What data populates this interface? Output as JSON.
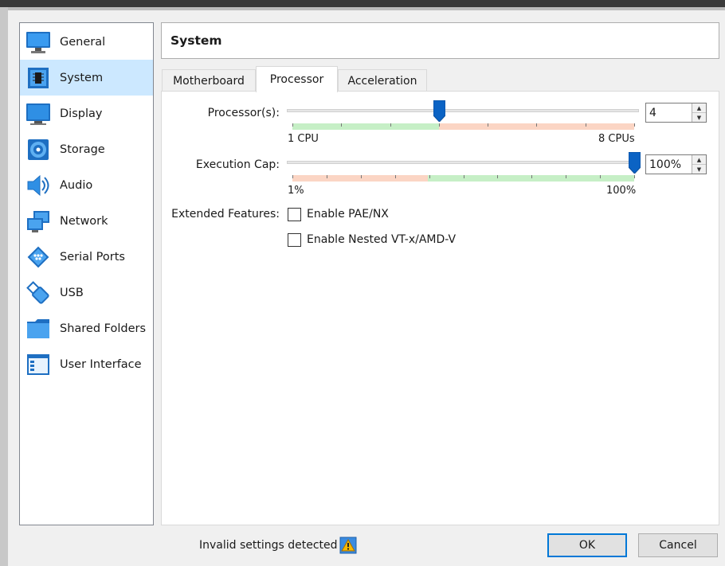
{
  "sidebar": {
    "items": [
      {
        "label": "General",
        "icon": "monitor-icon"
      },
      {
        "label": "System",
        "icon": "chip-icon",
        "selected": true
      },
      {
        "label": "Display",
        "icon": "display-icon"
      },
      {
        "label": "Storage",
        "icon": "disk-icon"
      },
      {
        "label": "Audio",
        "icon": "speaker-icon"
      },
      {
        "label": "Network",
        "icon": "network-icon"
      },
      {
        "label": "Serial Ports",
        "icon": "serial-port-icon"
      },
      {
        "label": "USB",
        "icon": "usb-icon"
      },
      {
        "label": "Shared Folders",
        "icon": "folder-icon"
      },
      {
        "label": "User Interface",
        "icon": "window-icon"
      }
    ]
  },
  "header": {
    "title": "System"
  },
  "tabs": [
    {
      "label": "Motherboard"
    },
    {
      "label": "Processor",
      "active": true
    },
    {
      "label": "Acceleration"
    }
  ],
  "processor": {
    "processors_label": "Processor(s):",
    "processors_value": "4",
    "processors_min_label": "1 CPU",
    "processors_max_label": "8 CPUs",
    "processors_fraction": 0.43,
    "exec_cap_label": "Execution Cap:",
    "exec_cap_value": "100%",
    "exec_cap_min_label": "1%",
    "exec_cap_max_label": "100%",
    "exec_cap_fraction": 1.0,
    "extended_label": "Extended Features:",
    "pae_label": "Enable PAE/NX",
    "pae_checked": false,
    "nested_label": "Enable Nested VT-x/AMD-V",
    "nested_checked": false
  },
  "footer": {
    "status_text": "Invalid settings detected",
    "status_icon": "warning-icon",
    "ok_label": "OK",
    "cancel_label": "Cancel"
  },
  "colors": {
    "selection": "#cce8ff",
    "green_band": "#c6efc6",
    "red_band": "#fbd5c4",
    "accent": "#0078d7"
  }
}
